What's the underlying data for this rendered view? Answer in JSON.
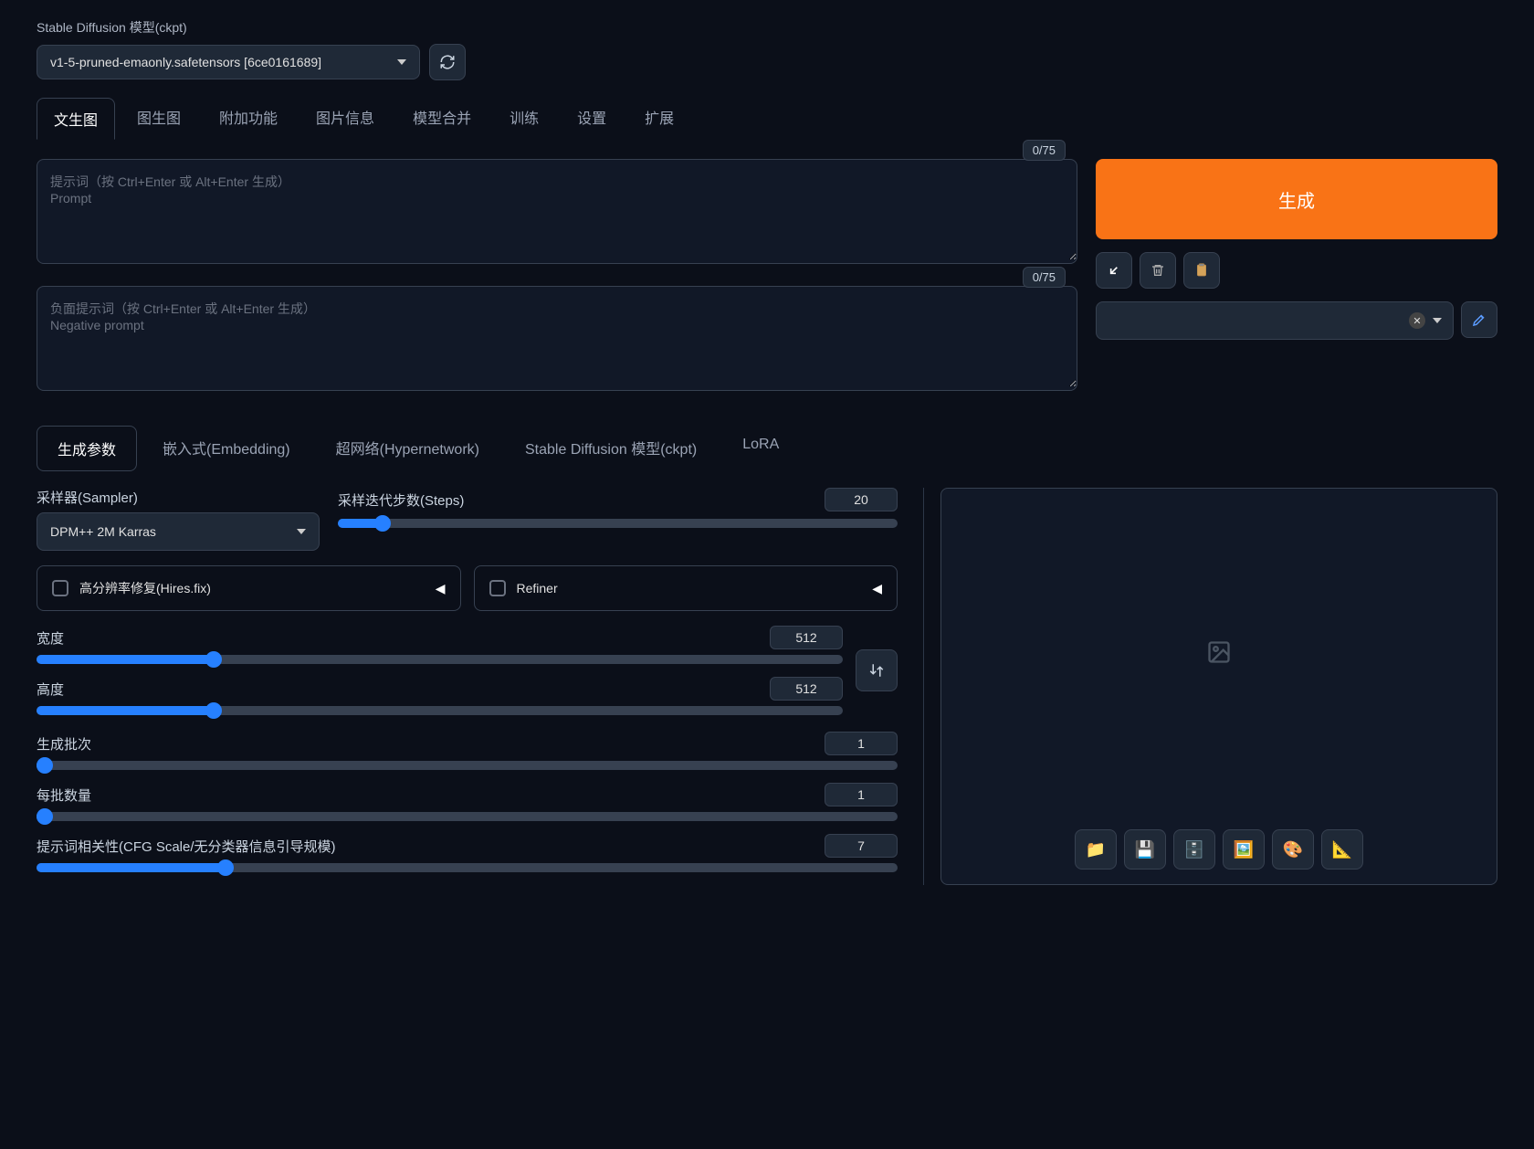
{
  "header": {
    "model_label": "Stable Diffusion 模型(ckpt)",
    "model_value": "v1-5-pruned-emaonly.safetensors [6ce0161689]"
  },
  "tabs": [
    "文生图",
    "图生图",
    "附加功能",
    "图片信息",
    "模型合并",
    "训练",
    "设置",
    "扩展"
  ],
  "active_tab": 0,
  "prompt": {
    "placeholder": "提示词（按 Ctrl+Enter 或 Alt+Enter 生成）\nPrompt",
    "counter": "0/75"
  },
  "neg_prompt": {
    "placeholder": "负面提示词（按 Ctrl+Enter 或 Alt+Enter 生成）\nNegative prompt",
    "counter": "0/75"
  },
  "generate_label": "生成",
  "subtabs": [
    "生成参数",
    "嵌入式(Embedding)",
    "超网络(Hypernetwork)",
    "Stable Diffusion 模型(ckpt)",
    "LoRA"
  ],
  "active_subtab": 0,
  "sampler": {
    "label": "采样器(Sampler)",
    "value": "DPM++ 2M Karras"
  },
  "steps": {
    "label": "采样迭代步数(Steps)",
    "value": "20",
    "fill": 8
  },
  "hires": {
    "label": "高分辨率修复(Hires.fix)"
  },
  "refiner": {
    "label": "Refiner"
  },
  "width": {
    "label": "宽度",
    "value": "512",
    "fill": 22
  },
  "height": {
    "label": "高度",
    "value": "512",
    "fill": 22
  },
  "batch_count": {
    "label": "生成批次",
    "value": "1",
    "fill": 1
  },
  "batch_size": {
    "label": "每批数量",
    "value": "1",
    "fill": 1
  },
  "cfg": {
    "label": "提示词相关性(CFG Scale/无分类器信息引导规模)",
    "value": "7",
    "fill": 22
  }
}
